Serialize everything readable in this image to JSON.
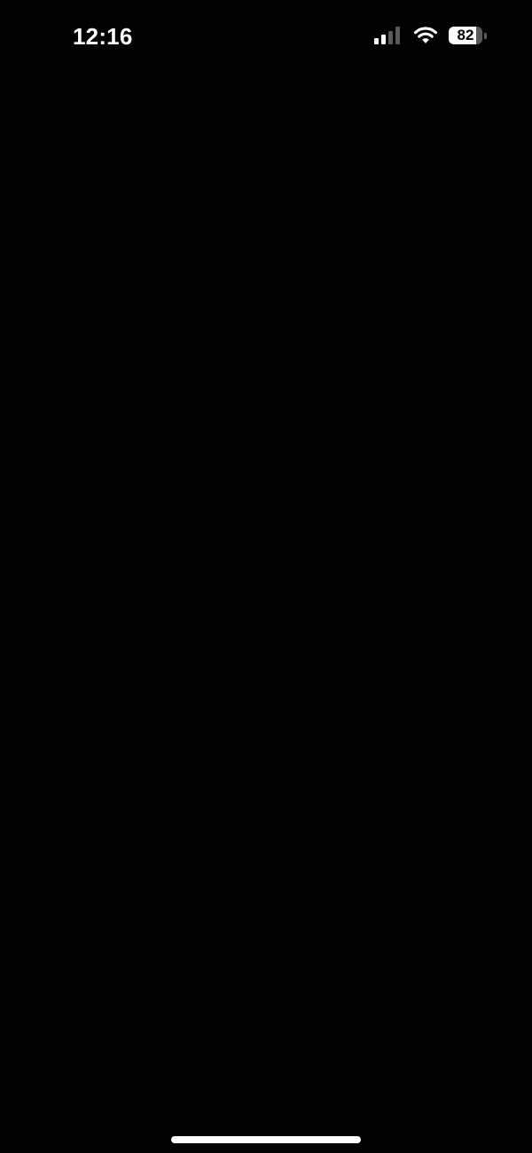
{
  "status_bar": {
    "time": "12:16",
    "battery_level_text": "82",
    "battery_fraction": 0.82,
    "signal_bars_active": 2,
    "signal_bars_total": 4,
    "icons": [
      "signal-icon",
      "wifi-icon",
      "battery-icon"
    ]
  },
  "colors": {
    "background": "#000000",
    "foreground": "#ffffff",
    "inactive": "#5a5a5a"
  }
}
